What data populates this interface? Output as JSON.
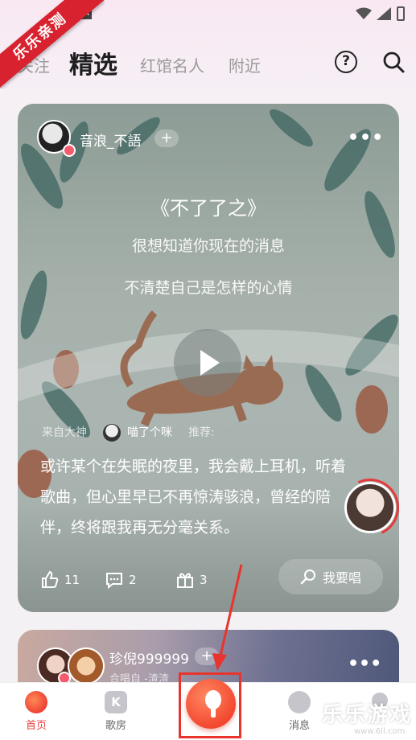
{
  "ribbon_text": "乐乐亲测",
  "tabs": [
    {
      "label": "关注"
    },
    {
      "label": "精选"
    },
    {
      "label": "红馆名人"
    },
    {
      "label": "附近"
    }
  ],
  "header": {
    "help_icon": "help-icon",
    "search_icon": "search-icon"
  },
  "card": {
    "username": "音浪_不語",
    "follow_label": "+",
    "more_label": "•••",
    "lyrics": {
      "title": "《不了了之》",
      "line1": "很想知道你现在的消息",
      "line2": "不清楚自己是怎样的心情"
    },
    "recommend": {
      "prefix": "来自大神",
      "name": "喵了个咪",
      "suffix": "推荐:"
    },
    "description": "或许某个在失眠的夜里，我会戴上耳机，听着歌曲，但心里早已不再惊涛骇浪，曾经的陪伴，终将跟我再无分毫关系。",
    "likes": "11",
    "comments": "2",
    "gifts": "3",
    "sing_label": "我要唱"
  },
  "card2": {
    "username": "珍倪999999",
    "follow_label": "+",
    "subtitle": "合唱自 -渣渣",
    "more_label": "•••"
  },
  "bottom_nav": [
    {
      "label": "首页"
    },
    {
      "label": "歌房"
    },
    {
      "label": "消息"
    },
    {
      "label": ""
    }
  ],
  "nav_k_glyph": "K",
  "watermark": {
    "text": "乐乐游戏",
    "url": "www.6ll.com"
  },
  "colors": {
    "accent": "#e8443e",
    "ribbon": "#d8222f"
  }
}
